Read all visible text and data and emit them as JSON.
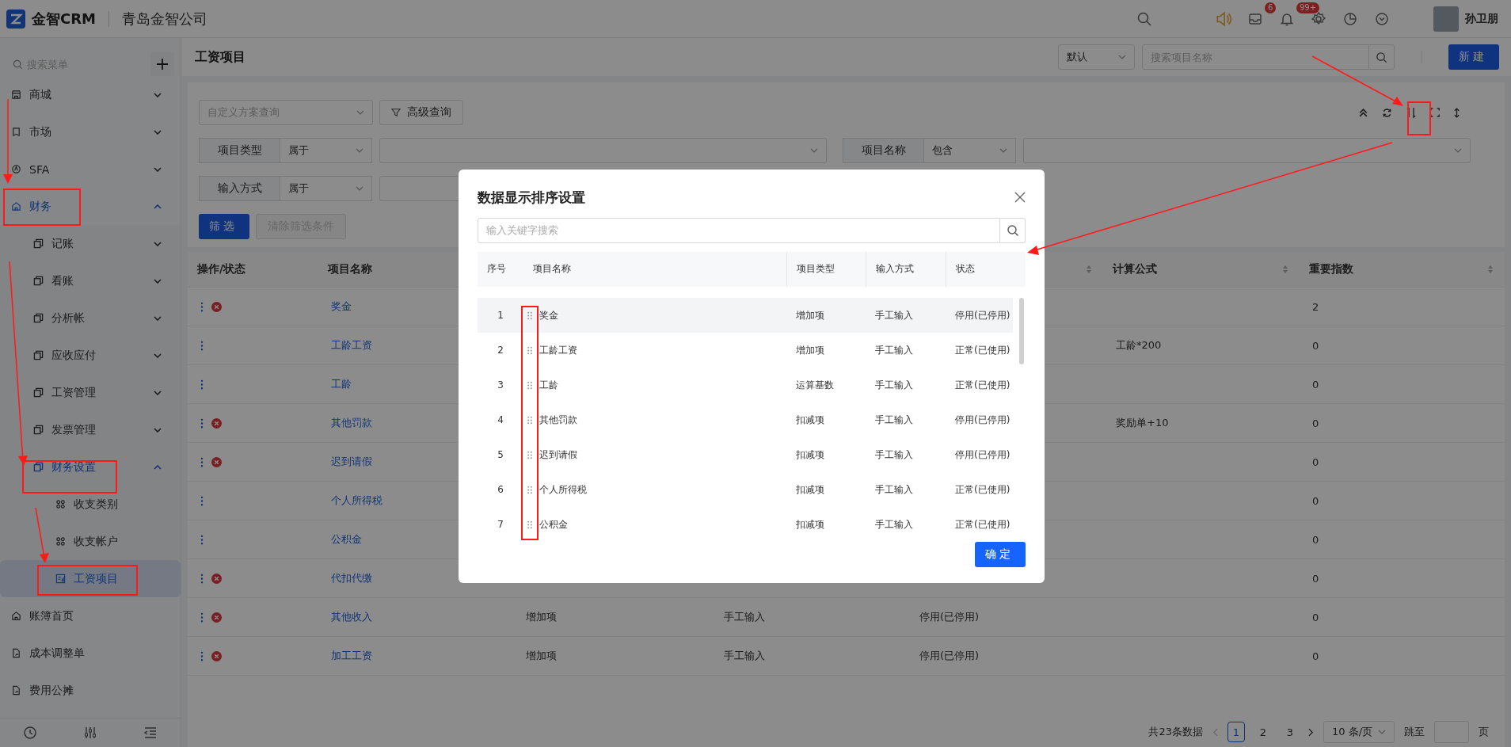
{
  "app": {
    "brand": "金智CRM",
    "company": "青岛金智公司"
  },
  "header_icons": [
    {
      "kind": "search"
    },
    {
      "kind": "speaker"
    },
    {
      "kind": "message",
      "badge": "6"
    },
    {
      "kind": "bell",
      "badge": "99+"
    },
    {
      "kind": "gear"
    },
    {
      "kind": "pie"
    },
    {
      "kind": "shield"
    }
  ],
  "user": {
    "name": "孙卫朋"
  },
  "sidebar": {
    "search_placeholder": "搜索菜单",
    "items": [
      {
        "label": "商城",
        "kind": "store",
        "expanded": false,
        "selected": false
      },
      {
        "label": "市场",
        "kind": "bookmark",
        "expanded": false,
        "selected": false
      },
      {
        "label": "SFA",
        "kind": "sfa",
        "expanded": false,
        "selected": false
      },
      {
        "label": "财务",
        "kind": "home",
        "expanded": true,
        "selected": false,
        "children": [
          {
            "label": "记账",
            "kind": "copy",
            "expanded": false,
            "selected": false
          },
          {
            "label": "看账",
            "kind": "copy",
            "expanded": false,
            "selected": false
          },
          {
            "label": "分析帐",
            "kind": "copy",
            "expanded": false,
            "selected": false
          },
          {
            "label": "应收应付",
            "kind": "copy",
            "expanded": false,
            "selected": false
          },
          {
            "label": "工资管理",
            "kind": "copy",
            "expanded": false,
            "selected": false
          },
          {
            "label": "发票管理",
            "kind": "copy",
            "expanded": false,
            "selected": false
          },
          {
            "label": "财务设置",
            "kind": "copy",
            "expanded": true,
            "selected": false,
            "children": [
              {
                "label": "收支类别",
                "kind": "grid",
                "selected": false
              },
              {
                "label": "收支帐户",
                "kind": "grid",
                "selected": false
              },
              {
                "label": "工资项目",
                "kind": "ledger",
                "selected": true
              }
            ]
          }
        ]
      },
      {
        "label": "账簿首页",
        "kind": "home",
        "selected": false
      },
      {
        "label": "成本调整单",
        "kind": "doc",
        "selected": false
      },
      {
        "label": "费用公摊",
        "kind": "doc",
        "selected": false
      }
    ]
  },
  "page": {
    "title": "工资项目",
    "view_select": "默认",
    "search_placeholder": "搜索项目名称",
    "new_button": "新建"
  },
  "filters": {
    "scheme_placeholder": "自定义方案查询",
    "advanced_button": "高级查询",
    "conditions": [
      {
        "field": "项目类型",
        "operator": "属于"
      },
      {
        "field": "项目名称",
        "operator": "包含"
      },
      {
        "field": "输入方式",
        "operator": "属于"
      }
    ],
    "apply_button": "筛选",
    "clear_button": {
      "label": "清除筛选条件",
      "disabled": true
    }
  },
  "table": {
    "columns": [
      {
        "label": "操作/状态",
        "sortable": false
      },
      {
        "label": "项目名称",
        "sortable": false
      },
      {},
      {},
      {
        "sortable": true
      },
      {
        "label": "计算公式",
        "sortable": true
      },
      {
        "label": "重要指数",
        "sortable": true
      }
    ],
    "rows": [
      {
        "stopped": true,
        "name": "奖金",
        "index": "2"
      },
      {
        "stopped": false,
        "name": "工龄工资",
        "formula": "工龄*200",
        "index": "0"
      },
      {
        "stopped": false,
        "name": "工龄",
        "index": "0"
      },
      {
        "stopped": true,
        "name": "其他罚款",
        "formula": "奖励单+10",
        "index": "0"
      },
      {
        "stopped": true,
        "name": "迟到请假",
        "index": "0"
      },
      {
        "stopped": false,
        "name": "个人所得税",
        "index": "0"
      },
      {
        "stopped": false,
        "name": "公积金",
        "index": "0"
      },
      {
        "stopped": true,
        "name": "代扣代缴",
        "index": "0"
      },
      {
        "stopped": true,
        "name": "其他收入",
        "type": "增加项",
        "input": "手工输入",
        "status": "停用(已停用)",
        "index": "0"
      },
      {
        "stopped": true,
        "name": "加工工资",
        "type": "增加项",
        "input": "手工输入",
        "status": "停用(已停用)",
        "index": "0"
      }
    ]
  },
  "pagination": {
    "total": "共23条数据",
    "pages": [
      {
        "label": "1",
        "selected": true
      },
      {
        "label": "2",
        "selected": false
      },
      {
        "label": "3",
        "selected": false
      }
    ],
    "page_size": "10 条/页",
    "jump_label": "跳至",
    "page_suffix": "页"
  },
  "dialog": {
    "title": "数据显示排序设置",
    "search_placeholder": "输入关键字搜索",
    "columns": [
      "序号",
      "项目名称",
      "项目类型",
      "输入方式",
      "状态"
    ],
    "rows": [
      {
        "index": "1",
        "name": "奖金",
        "type": "增加项",
        "input": "手工输入",
        "status": "停用(已停用)",
        "hovered": true
      },
      {
        "index": "2",
        "name": "工龄工资",
        "type": "增加项",
        "input": "手工输入",
        "status": "正常(已使用)",
        "hovered": false
      },
      {
        "index": "3",
        "name": "工龄",
        "type": "运算基数",
        "input": "手工输入",
        "status": "正常(已使用)",
        "hovered": false
      },
      {
        "index": "4",
        "name": "其他罚款",
        "type": "扣减项",
        "input": "手工输入",
        "status": "停用(已停用)",
        "hovered": false
      },
      {
        "index": "5",
        "name": "迟到请假",
        "type": "扣减项",
        "input": "手工输入",
        "status": "停用(已停用)",
        "hovered": false
      },
      {
        "index": "6",
        "name": "个人所得税",
        "type": "扣减项",
        "input": "手工输入",
        "status": "正常(已使用)",
        "hovered": false
      },
      {
        "index": "7",
        "name": "公积金",
        "type": "扣减项",
        "input": "手工输入",
        "status": "正常(已使用)",
        "hovered": false
      }
    ],
    "confirm_button": "确定"
  }
}
